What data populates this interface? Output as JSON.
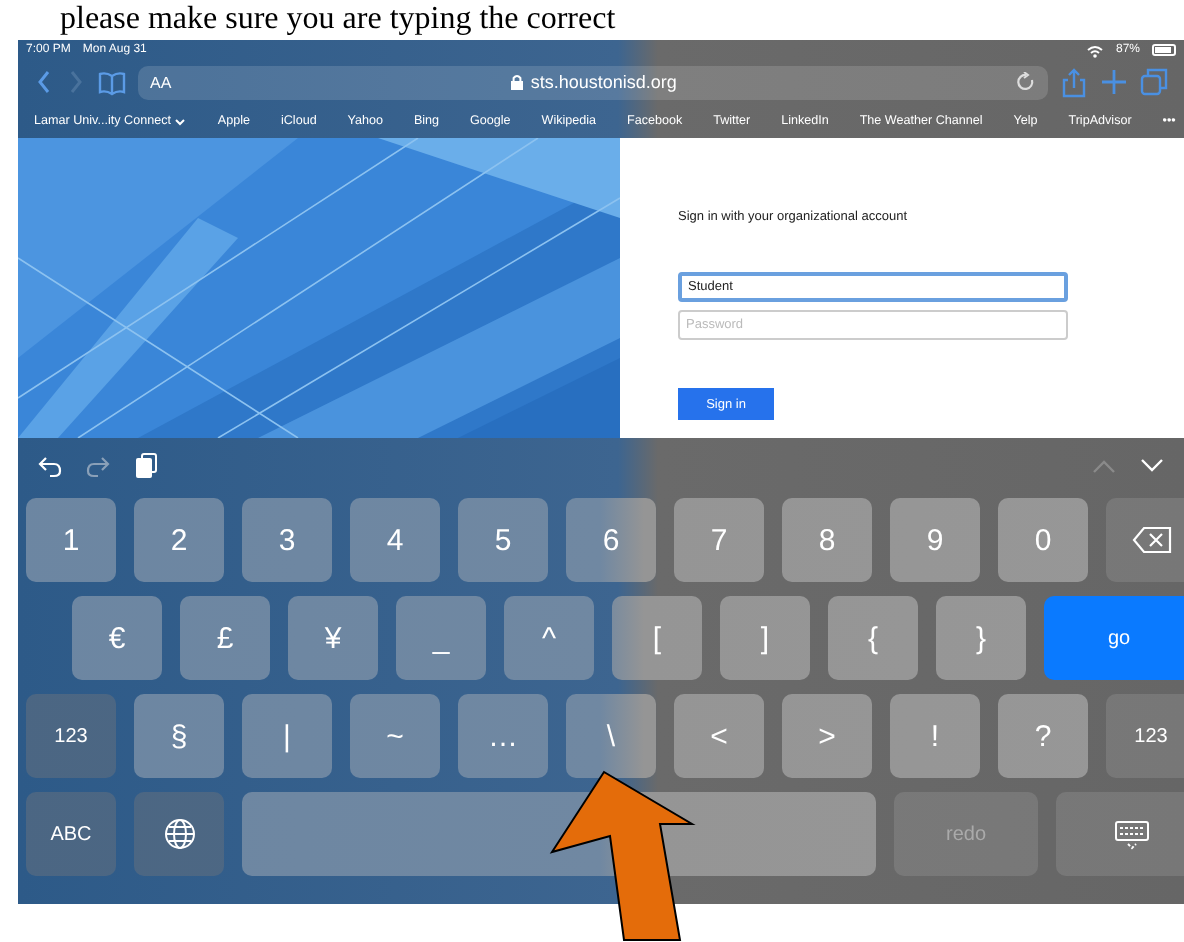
{
  "document_text": "please make sure you are typing the correct",
  "status_bar": {
    "time": "7:00 PM",
    "date": "Mon Aug 31",
    "battery": "87%"
  },
  "toolbar": {
    "text_size": "AA",
    "url": "sts.houstonisd.org"
  },
  "favorites": [
    {
      "label": "Lamar Univ...ity Connect",
      "kind": "folder"
    },
    {
      "label": "Apple",
      "kind": "link"
    },
    {
      "label": "iCloud",
      "kind": "link"
    },
    {
      "label": "Yahoo",
      "kind": "link"
    },
    {
      "label": "Bing",
      "kind": "link"
    },
    {
      "label": "Google",
      "kind": "link"
    },
    {
      "label": "Wikipedia",
      "kind": "link"
    },
    {
      "label": "Facebook",
      "kind": "link"
    },
    {
      "label": "Twitter",
      "kind": "link"
    },
    {
      "label": "LinkedIn",
      "kind": "link"
    },
    {
      "label": "The Weather Channel",
      "kind": "link"
    },
    {
      "label": "Yelp",
      "kind": "link"
    },
    {
      "label": "TripAdvisor",
      "kind": "link"
    },
    {
      "label": "•••",
      "kind": "more"
    }
  ],
  "login": {
    "heading": "Sign in with your organizational account",
    "username": {
      "value": "Student",
      "focused": true
    },
    "password": {
      "placeholder": "Password",
      "focused": false
    },
    "button": "Sign in"
  },
  "keyboard": {
    "rows": [
      [
        {
          "label": "1",
          "kind": "char"
        },
        {
          "label": "2",
          "kind": "char"
        },
        {
          "label": "3",
          "kind": "char"
        },
        {
          "label": "4",
          "kind": "char"
        },
        {
          "label": "5",
          "kind": "char"
        },
        {
          "label": "6",
          "kind": "char"
        },
        {
          "label": "7",
          "kind": "char"
        },
        {
          "label": "8",
          "kind": "char"
        },
        {
          "label": "9",
          "kind": "char"
        },
        {
          "label": "0",
          "kind": "char"
        },
        {
          "kind": "delete"
        }
      ],
      [
        {
          "label": "€",
          "kind": "char"
        },
        {
          "label": "£",
          "kind": "char"
        },
        {
          "label": "¥",
          "kind": "char"
        },
        {
          "label": "_",
          "kind": "char"
        },
        {
          "label": "^",
          "kind": "char"
        },
        {
          "label": "[",
          "kind": "char"
        },
        {
          "label": "]",
          "kind": "char"
        },
        {
          "label": "{",
          "kind": "char"
        },
        {
          "label": "}",
          "kind": "char"
        },
        {
          "label": "go",
          "kind": "action"
        }
      ],
      [
        {
          "label": "123",
          "kind": "mode"
        },
        {
          "label": "§",
          "kind": "char"
        },
        {
          "label": "|",
          "kind": "char"
        },
        {
          "label": "~",
          "kind": "char"
        },
        {
          "label": "…",
          "kind": "char"
        },
        {
          "label": "\\",
          "kind": "char"
        },
        {
          "label": "<",
          "kind": "char"
        },
        {
          "label": ">",
          "kind": "char"
        },
        {
          "label": "!",
          "kind": "char"
        },
        {
          "label": "?",
          "kind": "char"
        },
        {
          "label": "123",
          "kind": "mode"
        }
      ],
      [
        {
          "label": "ABC",
          "kind": "mode"
        },
        {
          "kind": "globe"
        },
        {
          "kind": "space"
        },
        {
          "label": "redo",
          "kind": "dim"
        },
        {
          "kind": "hide"
        }
      ]
    ]
  }
}
